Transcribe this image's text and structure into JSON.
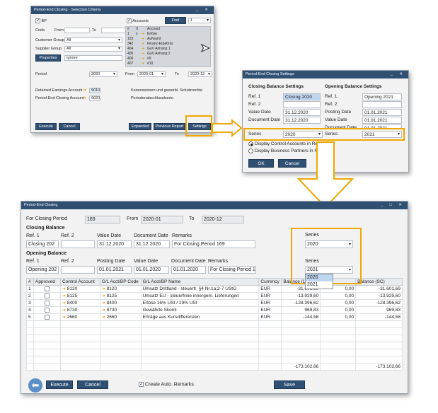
{
  "colors": {
    "accent": "#f0a800",
    "title_bar": "#2f4f73"
  },
  "criteria": {
    "title": "Period-End Closing - Selection Criteria",
    "bp_label": "BP",
    "code_label": "Code",
    "from_label": "From",
    "to_label": "To",
    "customer_group_label": "Customer Group",
    "customer_group_value": "All",
    "supplier_group_label": "Supplier Group",
    "supplier_group_value": "All",
    "properties_button": "Properties",
    "properties_value": "Ignore",
    "accounts_label": "Accounts",
    "find_button": "Find",
    "find_value": "1",
    "accounts_headers": [
      "#",
      "X",
      "Account"
    ],
    "accounts_rows": [
      {
        "num": "1",
        "x": "x",
        "name": "Erlöse"
      },
      {
        "num": "123",
        "x": "",
        "name": "Aufwand"
      },
      {
        "num": "342",
        "x": "",
        "name": "Finanz-Ergebnis"
      },
      {
        "num": "404",
        "x": "",
        "name": "GuV Anhang 1"
      },
      {
        "num": "405",
        "x": "",
        "name": "GuV Anhang 2"
      },
      {
        "num": "406",
        "x": "",
        "name": "#9"
      },
      {
        "num": "407",
        "x": "",
        "name": "#10"
      }
    ],
    "period_label": "Period",
    "period_value": "2020",
    "period_from_label": "From",
    "period_from_value": "2020-01",
    "period_to_label": "To",
    "period_to_value": "2020-12",
    "retained_label": "Retained Earnings Account",
    "retained_value": "9010",
    "retained_desc": "Konzessionen und gewerbl. Schutzrechte",
    "closing_account_label": "Period-End Closing Account",
    "closing_account_value": "9020",
    "closing_account_desc": "Periodenabschlusskonto",
    "execute_button": "Execute",
    "cancel_button": "Cancel",
    "expanded_button": "Expanded",
    "previous_report_button": "Previous Report",
    "settings_button": "Settings"
  },
  "settings": {
    "title": "Period-End Closing Settings",
    "closing_heading": "Closing Balance Settings",
    "opening_heading": "Opening Balance Settings",
    "ref1_label": "Ref. 1",
    "ref2_label": "Ref. 2",
    "closing_ref1": "Closing 2020",
    "opening_ref1": "Opening 2021",
    "value_date_label": "Value Date",
    "closing_value_date": "31.12.2020",
    "posting_date_label": "Posting Date",
    "opening_posting_date": "01.01.2021",
    "document_date_label": "Document Date",
    "closing_document_date": "31.12.2020",
    "opening_value_date": "01.01.2021",
    "opening_document_date": "01.01.2021",
    "series_label": "Series",
    "closing_series": "2020",
    "opening_series": "2021",
    "radio_control": "Display Control Accounts in Report",
    "radio_bp": "Display Business Partners in Report",
    "ok_button": "OK",
    "cancel_button": "Cancel"
  },
  "main": {
    "title": "Period-End Closing",
    "for_period_label": "For Closing Period",
    "for_period_value": "169",
    "from_label": "From",
    "from_value": "2020-01",
    "to_label": "To",
    "to_value": "2020-12",
    "closing_heading": "Closing Balance",
    "opening_heading": "Opening Balance",
    "ref1_label": "Ref. 1",
    "ref2_label": "Ref. 2",
    "value_date_label": "Value Date",
    "document_date_label": "Document Date",
    "posting_date_label": "Posting Date",
    "remarks_label": "Remarks",
    "series_label": "Series",
    "closing_ref1": "Closing 202",
    "closing_value_date": "31.12.2020",
    "closing_document_date": "31.12.2020",
    "closing_remarks": "For Closing Period 169",
    "closing_series": "2020",
    "opening_ref1": "Opening 202",
    "opening_posting_date": "01.01.2021",
    "opening_value_date": "01.01.2020",
    "opening_document_date": "01.01.2020",
    "opening_remarks": "For Closing Period 169",
    "opening_series": "2021",
    "series_options": [
      "2020",
      "2021"
    ],
    "table_headers": [
      "#",
      "Approved",
      "Control Account",
      "G/L Acct/BP Code",
      "G/L Acct/BP Name",
      "Currency",
      "Balance (LC)",
      "",
      "Balance (SC)"
    ],
    "rows": [
      {
        "num": "1",
        "ctrl": "8120",
        "code": "8120",
        "name": "Umsatz Drittland - steuerfr. §4 Nr.1a,2-7 UStG",
        "cur": "EUR",
        "bal_lc": "-31.601,69",
        "mid": "0,00",
        "bal_sc": "-31.601,69"
      },
      {
        "num": "2",
        "ctrl": "8125",
        "code": "8125",
        "name": "Umsatz EU - steuerfreie innergem. Lieferungen",
        "cur": "EUR",
        "bal_lc": "-13.929,60",
        "mid": "0,00",
        "bal_sc": "-13.929,60"
      },
      {
        "num": "3",
        "ctrl": "8400",
        "code": "8400",
        "name": "Erlöse 16% USt / 19% USt",
        "cur": "EUR",
        "bal_lc": "-128.396,62",
        "mid": "0,00",
        "bal_sc": "-128.396,62"
      },
      {
        "num": "4",
        "ctrl": "8730",
        "code": "8730",
        "name": "Gewährte Skonti",
        "cur": "EUR",
        "bal_lc": "969,83",
        "mid": "0,00",
        "bal_sc": "969,83"
      },
      {
        "num": "5",
        "ctrl": "2660",
        "code": "2660",
        "name": "Erträge aus Kursdifferenzen",
        "cur": "EUR",
        "bal_lc": "-144,58",
        "mid": "0,00",
        "bal_sc": "-144,58"
      }
    ],
    "total_lc": "-173.102,66",
    "total_sc": "-173.102,66",
    "execute_button": "Execute",
    "cancel_button": "Cancel",
    "create_remarks_label": "Create Auto. Remarks",
    "save_button": "Save"
  }
}
